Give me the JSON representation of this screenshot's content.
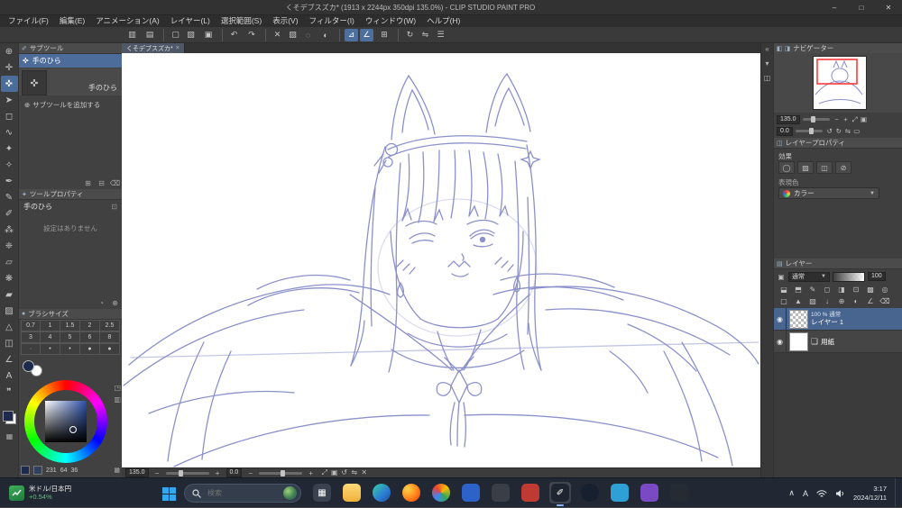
{
  "window": {
    "title": "くそデブスズカ* (1913 x 2244px 350dpi 135.0%) - CLIP STUDIO PAINT PRO",
    "minimize": "–",
    "maximize": "□",
    "close": "✕"
  },
  "menu": [
    "ファイル(F)",
    "編集(E)",
    "アニメーション(A)",
    "レイヤー(L)",
    "選択範囲(S)",
    "表示(V)",
    "フィルター(I)",
    "ウィンドウ(W)",
    "ヘルプ(H)"
  ],
  "toolbar": [
    {
      "name": "palette-dock-icon",
      "glyph": "▥"
    },
    {
      "name": "workspace-icon",
      "glyph": "▤",
      "sep": true
    },
    {
      "name": "new-file-icon",
      "glyph": "▢"
    },
    {
      "name": "open-file-icon",
      "glyph": "▧"
    },
    {
      "name": "save-icon",
      "glyph": "▣",
      "sep": true
    },
    {
      "name": "undo-icon",
      "glyph": "↶"
    },
    {
      "name": "redo-icon",
      "glyph": "↷",
      "sep": true
    },
    {
      "name": "delete-icon",
      "glyph": "✕"
    },
    {
      "name": "fill-selection-icon",
      "glyph": "▨"
    },
    {
      "name": "deselect-icon",
      "glyph": "◌"
    },
    {
      "name": "invert-selection-icon",
      "glyph": "◐",
      "sep": true
    },
    {
      "name": "snap-to-ruler-icon",
      "glyph": "⊿",
      "active": true
    },
    {
      "name": "snap-to-special-ruler-icon",
      "glyph": "∠",
      "active": true
    },
    {
      "name": "snap-to-grid-icon",
      "glyph": "⊞",
      "sep": true
    },
    {
      "name": "rotate-view-icon",
      "glyph": "↻"
    },
    {
      "name": "flip-view-icon",
      "glyph": "⇋"
    },
    {
      "name": "material-palette-icon",
      "glyph": "☰"
    }
  ],
  "tools": [
    {
      "name": "zoom-tool",
      "glyph": "⊕"
    },
    {
      "name": "move-tool",
      "glyph": "✛"
    },
    {
      "name": "hand-tool",
      "glyph": "✜",
      "active": true
    },
    {
      "name": "operation-tool",
      "glyph": "➤"
    },
    {
      "name": "selection-tool",
      "glyph": "◻"
    },
    {
      "name": "lasso-tool",
      "glyph": "∿"
    },
    {
      "name": "auto-select-tool",
      "glyph": "✦"
    },
    {
      "name": "eyedropper-tool",
      "glyph": "✧"
    },
    {
      "name": "pen-tool",
      "glyph": "✒"
    },
    {
      "name": "pencil-tool",
      "glyph": "✎"
    },
    {
      "name": "brush-tool",
      "glyph": "✐"
    },
    {
      "name": "airbrush-tool",
      "glyph": "⁂"
    },
    {
      "name": "decoration-tool",
      "glyph": "❈"
    },
    {
      "name": "eraser-tool",
      "glyph": "▱"
    },
    {
      "name": "blend-tool",
      "glyph": "❋"
    },
    {
      "name": "fill-tool",
      "glyph": "▰"
    },
    {
      "name": "gradient-tool",
      "glyph": "▨"
    },
    {
      "name": "figure-tool",
      "glyph": "△"
    },
    {
      "name": "frame-border-tool",
      "glyph": "◫"
    },
    {
      "name": "ruler-tool",
      "glyph": "∠"
    },
    {
      "name": "text-tool",
      "glyph": "A"
    },
    {
      "name": "balloon-tool",
      "glyph": "❞"
    }
  ],
  "subtool": {
    "title": "サブツール",
    "selected": "手のひら",
    "tile_label": "手のひら",
    "add_icon": "⊕",
    "add_label": "サブツールを追加する",
    "footer_icons": [
      {
        "name": "add-subtool-icon",
        "glyph": "⊞"
      },
      {
        "name": "duplicate-subtool-icon",
        "glyph": "⊟"
      },
      {
        "name": "delete-subtool-icon",
        "glyph": "⌫"
      }
    ]
  },
  "tool_property": {
    "title": "ツールプロパティ",
    "tool": "手のひら",
    "lock_icon": "⊡",
    "empty": "設定はありません",
    "footer_icons": [
      {
        "name": "reset-icon",
        "glyph": "◔"
      },
      {
        "name": "detail-icon",
        "glyph": "⊕"
      }
    ]
  },
  "brush_size": {
    "title": "ブラシサイズ",
    "row1": [
      "0.7",
      "1",
      "1.5",
      "2",
      "2.5"
    ],
    "row2": [
      "3",
      "4",
      "5",
      "6",
      "8"
    ],
    "row3": [
      "·",
      "•",
      "•",
      "●",
      "●"
    ]
  },
  "color_wheel": {
    "values": [
      "231",
      "64",
      "36"
    ],
    "grid_icon": "▦",
    "side_icons": [
      {
        "name": "color-wheel-mode-icon",
        "glyph": "◳"
      },
      {
        "name": "color-slider-mode-icon",
        "glyph": "▥"
      }
    ]
  },
  "doc": {
    "tab": "くそデブスズカ*",
    "tab_close": "×",
    "zoom": "135.0",
    "rotation": "0.0",
    "minus": "−",
    "plus": "+",
    "status_icons": [
      {
        "name": "fit-to-screen-icon",
        "glyph": "⤢"
      },
      {
        "name": "actual-size-icon",
        "glyph": "▣"
      },
      {
        "name": "rotate-reset-icon",
        "glyph": "↺"
      },
      {
        "name": "flip-horizontal-icon",
        "glyph": "⇋"
      },
      {
        "name": "clear-rotation-icon",
        "glyph": "✕"
      }
    ]
  },
  "right_strip": [
    {
      "name": "collapse-panels-icon",
      "glyph": "«"
    },
    {
      "name": "panel-menu-icon",
      "glyph": "▾"
    },
    {
      "name": "panel-dock-icon",
      "glyph": "◫"
    }
  ],
  "navigator": {
    "title": "ナビゲーター",
    "tab_icons": [
      {
        "name": "navigator-tab-icon",
        "glyph": "◧"
      },
      {
        "name": "subview-tab-icon",
        "glyph": "◨"
      }
    ],
    "menu_icon": "≡",
    "zoom": "135.0",
    "rotation": "0.0",
    "zoom_icons": [
      {
        "name": "zoom-out-icon",
        "glyph": "−"
      },
      {
        "name": "zoom-in-icon",
        "glyph": "+"
      },
      {
        "name": "fit-icon",
        "glyph": "⤢"
      },
      {
        "name": "actual-pixel-icon",
        "glyph": "▣"
      }
    ],
    "rot_icons": [
      {
        "name": "rotate-left-icon",
        "glyph": "↺"
      },
      {
        "name": "rotate-right-icon",
        "glyph": "↻"
      },
      {
        "name": "flip-horizontal-icon",
        "glyph": "⇋"
      },
      {
        "name": "reset-rotation-icon",
        "glyph": "▭"
      }
    ]
  },
  "layer_property": {
    "title": "レイヤープロパティ",
    "effect_label": "効果",
    "effect_icons": [
      {
        "name": "border-effect-icon",
        "glyph": "◯"
      },
      {
        "name": "tone-effect-icon",
        "glyph": "▨"
      },
      {
        "name": "layer-color-icon",
        "glyph": "◫"
      },
      {
        "name": "no-effect-icon",
        "glyph": "⊘"
      }
    ],
    "expression_label": "表現色",
    "color_mode": "カラー",
    "caret": "▼"
  },
  "layers": {
    "title": "レイヤー",
    "palette_icon": "▣",
    "blend": "通常",
    "caret": "▼",
    "opacity": "100",
    "row1_icons": [
      {
        "name": "transfer-down-icon",
        "glyph": "⬓"
      },
      {
        "name": "merge-down-icon",
        "glyph": "⬒"
      },
      {
        "name": "draft-layer-icon",
        "glyph": "✎"
      },
      {
        "name": "selection-from-layer-icon",
        "glyph": "◻"
      },
      {
        "name": "clip-at-layer-icon",
        "glyph": "◨"
      },
      {
        "name": "lock-layer-icon",
        "glyph": "⊡"
      },
      {
        "name": "lock-alpha-icon",
        "glyph": "▩"
      },
      {
        "name": "reference-layer-icon",
        "glyph": "◎"
      }
    ],
    "row2_icons": [
      {
        "name": "new-raster-layer-icon",
        "glyph": "▢"
      },
      {
        "name": "new-vector-layer-icon",
        "glyph": "▲"
      },
      {
        "name": "new-folder-icon",
        "glyph": "▧"
      },
      {
        "name": "transfer-icon",
        "glyph": "↓"
      },
      {
        "name": "combine-icon",
        "glyph": "⊕"
      },
      {
        "name": "layer-mask-icon",
        "glyph": "◐"
      },
      {
        "name": "ruler-icon",
        "glyph": "∠"
      },
      {
        "name": "delete-layer-icon",
        "glyph": "⌫"
      }
    ],
    "eye_icon": "◉",
    "items": [
      {
        "meta": "100 % 通常",
        "name": "レイヤー 1",
        "selected": true
      },
      {
        "meta": "",
        "name": "用紙",
        "selected": false
      }
    ],
    "paper_icon": "❏"
  },
  "taskbar": {
    "widget": {
      "line1": "米ドル/日本円",
      "line2": "+0.54%"
    },
    "search": "検索",
    "apps": [
      {
        "name": "task-view",
        "bg": "#39424e",
        "radius": "5px",
        "glyph": "▦"
      },
      {
        "name": "file-explorer",
        "bg": "linear-gradient(180deg,#ffd977,#f0b23c)",
        "radius": "5px",
        "glyph": ""
      },
      {
        "name": "edge",
        "bg": "linear-gradient(135deg,#35d2a2,#2b7cd3 60%,#174f9e)",
        "radius": "50%",
        "glyph": ""
      },
      {
        "name": "firefox",
        "bg": "radial-gradient(circle at 30% 30%,#ffd54a,#ff7a18 60%,#e0340b)",
        "radius": "50%",
        "glyph": ""
      },
      {
        "name": "chrome",
        "bg": "conic-gradient(from -45deg,#ea4335,#fbbc05,#34a853,#4285f4,#ea4335)",
        "radius": "50%",
        "glyph": ""
      },
      {
        "name": "photos",
        "bg": "#2d63c8",
        "radius": "5px",
        "glyph": ""
      },
      {
        "name": "discord",
        "bg": "#3a3f47",
        "radius": "5px",
        "glyph": ""
      },
      {
        "name": "game-launcher",
        "bg": "#c03a34",
        "radius": "5px",
        "glyph": ""
      },
      {
        "name": "clip-studio-paint",
        "bg": "#1e2430",
        "radius": "5px",
        "glyph": "✐",
        "active": true
      },
      {
        "name": "steam",
        "bg": "#17202e",
        "radius": "50%",
        "glyph": ""
      },
      {
        "name": "paint-app",
        "bg": "#2ea0d6",
        "radius": "5px",
        "glyph": ""
      },
      {
        "name": "creative-app",
        "bg": "#7a49c4",
        "radius": "5px",
        "glyph": ""
      },
      {
        "name": "terminal",
        "bg": "#262b33",
        "radius": "5px",
        "glyph": ""
      }
    ],
    "tray": {
      "chevron": "∧",
      "ime": "A",
      "time": "3:17",
      "date": "2024/12/11"
    }
  }
}
